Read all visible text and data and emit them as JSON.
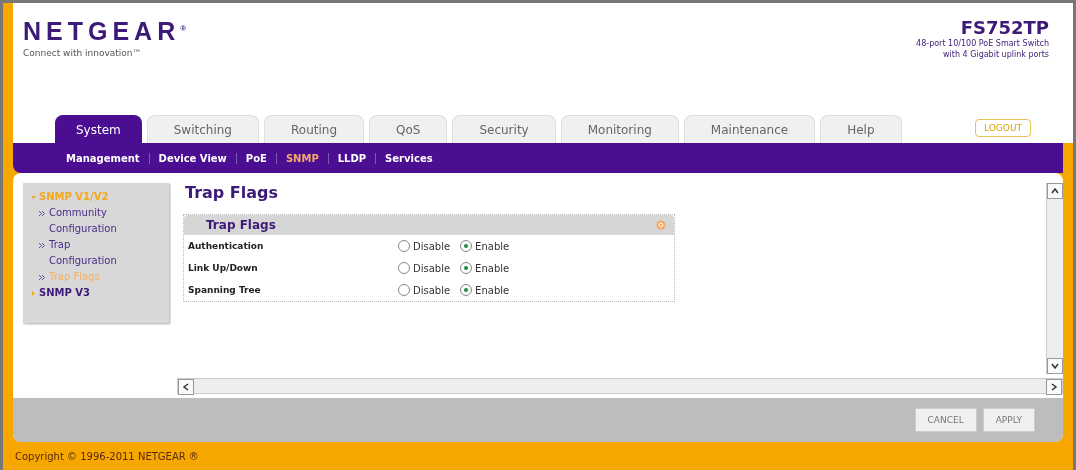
{
  "brand": {
    "logo": "NETGEAR",
    "registered": "®",
    "tagline": "Connect with innovation™"
  },
  "product": {
    "model": "FS752TP",
    "description_lines": [
      "48-port 10/100 PoE Smart Switch",
      "with 4 Gigabit uplink ports"
    ]
  },
  "logout": "LOGOUT",
  "tabs": [
    {
      "label": "System",
      "selected": true
    },
    {
      "label": "Switching",
      "selected": false
    },
    {
      "label": "Routing",
      "selected": false
    },
    {
      "label": "QoS",
      "selected": false
    },
    {
      "label": "Security",
      "selected": false
    },
    {
      "label": "Monitoring",
      "selected": false
    },
    {
      "label": "Maintenance",
      "selected": false
    },
    {
      "label": "Help",
      "selected": false
    }
  ],
  "subnav": [
    {
      "label": "Management",
      "selected": false
    },
    {
      "label": "Device View",
      "selected": false
    },
    {
      "label": "PoE",
      "selected": false
    },
    {
      "label": "SNMP",
      "selected": true
    },
    {
      "label": "LLDP",
      "selected": false
    },
    {
      "label": "Services",
      "selected": false
    }
  ],
  "sidebar": {
    "items": [
      {
        "label": "SNMP V1/V2",
        "selected": true,
        "expanded": true,
        "children": [
          {
            "label": "Community Configuration",
            "selected": false
          },
          {
            "label": "Trap Configuration",
            "selected": false
          },
          {
            "label": "Trap Flags",
            "selected": true
          }
        ]
      },
      {
        "label": "SNMP V3",
        "selected": false,
        "expanded": false
      }
    ]
  },
  "page_title": "Trap Flags",
  "panel": {
    "title": "Trap Flags",
    "rows": [
      {
        "label": "Authentication",
        "options": [
          {
            "label": "Disable",
            "selected": false
          },
          {
            "label": "Enable",
            "selected": true
          }
        ]
      },
      {
        "label": "Link Up/Down",
        "options": [
          {
            "label": "Disable",
            "selected": false
          },
          {
            "label": "Enable",
            "selected": true
          }
        ]
      },
      {
        "label": "Spanning Tree",
        "options": [
          {
            "label": "Disable",
            "selected": false
          },
          {
            "label": "Enable",
            "selected": true
          }
        ]
      }
    ]
  },
  "buttons": [
    "CANCEL",
    "APPLY"
  ],
  "footer": "Copyright © 1996-2011 NETGEAR ®"
}
